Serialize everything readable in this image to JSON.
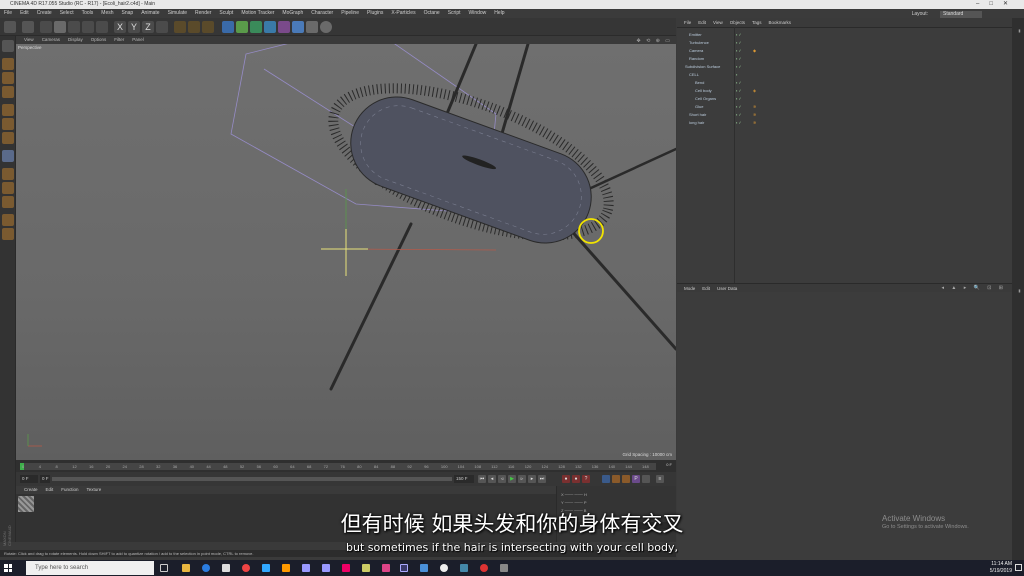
{
  "window": {
    "title": "CINEMA 4D R17.055 Studio (RC - R17) - [Ecoli_hair2.c4d] - Main",
    "controls": [
      "–",
      "□",
      "✕"
    ]
  },
  "menu": [
    "File",
    "Edit",
    "Create",
    "Select",
    "Tools",
    "Mesh",
    "Snap",
    "Animate",
    "Simulate",
    "Render",
    "Sculpt",
    "Motion Tracker",
    "MoGraph",
    "Character",
    "Pipeline",
    "Plugins",
    "X-Particles",
    "Octane",
    "Script",
    "Window",
    "Help"
  ],
  "layout": {
    "label": "Layout:",
    "value": "Standard"
  },
  "viewport": {
    "menu": [
      "View",
      "Cameras",
      "Display",
      "Options",
      "Filter",
      "Panel"
    ],
    "label": "Perspective",
    "grid_spacing": "Grid Spacing : 10000 cm"
  },
  "timeline": {
    "ticks": [
      "0",
      "4",
      "8",
      "12",
      "16",
      "20",
      "24",
      "28",
      "32",
      "36",
      "40",
      "44",
      "48",
      "52",
      "56",
      "60",
      "64",
      "68",
      "72",
      "76",
      "80",
      "84",
      "88",
      "92",
      "96",
      "100",
      "104",
      "108",
      "112",
      "116",
      "120",
      "124",
      "128",
      "132",
      "136",
      "140",
      "144",
      "148"
    ],
    "frame_end_marker": "0 F",
    "current": "0 F",
    "start": "0 F",
    "end": "150 F"
  },
  "material_manager": {
    "menu": [
      "Create",
      "Edit",
      "Function",
      "Texture"
    ]
  },
  "object_manager": {
    "menu": [
      "File",
      "Edit",
      "View",
      "Objects",
      "Tags",
      "Bookmarks"
    ],
    "objects": [
      "Emitter",
      "Turbulence",
      "Camera",
      "Random",
      "Subdivision Surface",
      "CELL",
      "Bend",
      "Cell body",
      "Cell Organs",
      "Glue",
      "Short hair",
      "long hair"
    ]
  },
  "attribute_manager": {
    "menu": [
      "Mode",
      "Edit",
      "User Data"
    ]
  },
  "statusbar": "Rotate: Click and drag to rotate elements. Hold down SHIFT to add to quantize rotation / add to the selection in point mode, CTRL to remove.",
  "subtitles": {
    "chinese": "但有时候 如果头发和你的身体有交叉",
    "english": "but sometimes if the hair is intersecting with your cell body,"
  },
  "watermark": {
    "line1": "Activate Windows",
    "line2": "Go to Settings to activate Windows."
  },
  "taskbar": {
    "search_placeholder": "Type here to search",
    "time": "11:14 AM",
    "date": "5/19/2019"
  },
  "side_label": "MAXON CINEMA4D",
  "icons": [
    "undo-icon",
    "move-icon",
    "scale-icon",
    "rotate-icon",
    "x-axis-icon",
    "y-axis-icon",
    "z-axis-icon",
    "render-icon",
    "cube-icon",
    "windows-start-icon"
  ],
  "colors": {
    "accent": "#e8a23a",
    "selection_circle": "#f2e400",
    "taskbar": "#1b1e2a"
  }
}
